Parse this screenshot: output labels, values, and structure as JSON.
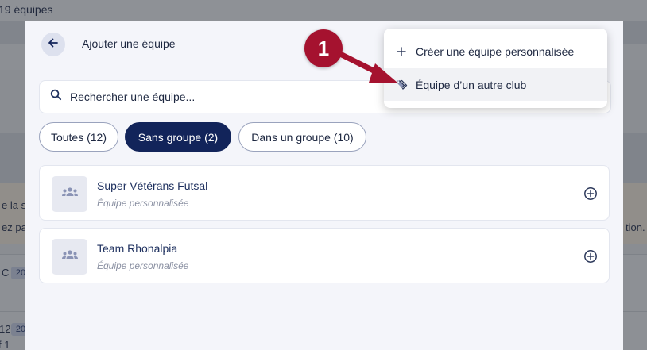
{
  "background": {
    "team_count": "19 équipes",
    "snippet_1": "e la s",
    "snippet_2": "ez pa",
    "snippet_3": "tion.",
    "chip_1": "20",
    "chip_2": "20",
    "row_text_1": "12",
    "row_text_2": "C",
    "row_text_3": "f 1"
  },
  "modal": {
    "title": "Ajouter une équipe",
    "search_placeholder": "Rechercher une équipe...",
    "filters": [
      {
        "label": "Toutes (12)",
        "active": false
      },
      {
        "label": "Sans groupe (2)",
        "active": true
      },
      {
        "label": "Dans un groupe (10)",
        "active": false
      }
    ],
    "teams": [
      {
        "name": "Super Vétérans Futsal",
        "type": "Équipe personnalisée"
      },
      {
        "name": "Team Rhonalpia",
        "type": "Équipe personnalisée"
      }
    ]
  },
  "dropdown": {
    "items": [
      {
        "label": "Créer une équipe personnalisée",
        "icon": "plus-icon"
      },
      {
        "label": "Équipe d’un autre club",
        "icon": "tag-icon"
      }
    ]
  },
  "annotation": {
    "step": "1"
  },
  "colors": {
    "navy": "#12245a",
    "annotation_red": "#a5122f"
  }
}
